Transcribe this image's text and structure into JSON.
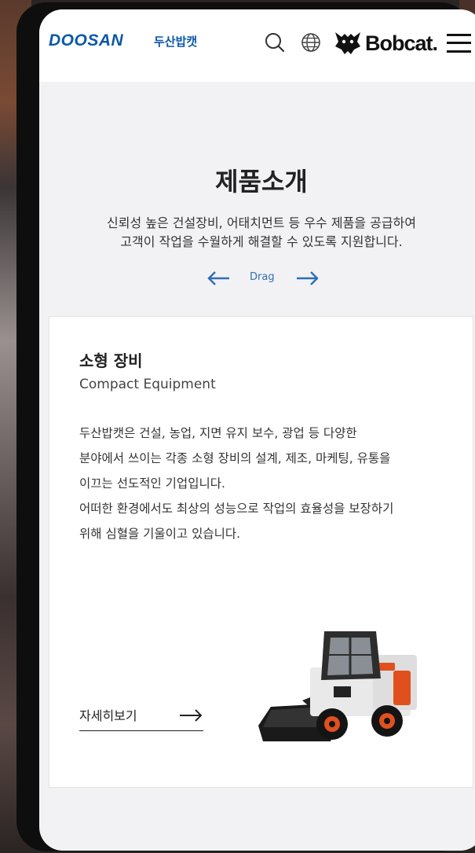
{
  "header": {
    "brand_name": "DOOSAN",
    "brand_korean": "두산밥캣",
    "partner_brand": "Bobcat.",
    "icons": [
      "search-icon",
      "globe-icon",
      "bobcat-logo-icon",
      "hamburger-menu-icon"
    ]
  },
  "intro": {
    "title": "제품소개",
    "description_lines": [
      "신뢰성 높은 건설장비, 어태치먼트 등 우수 제품을 공급하여",
      "고객이 작업을 수월하게 해결할 수 있도록 지원합니다."
    ],
    "drag_label": "Drag"
  },
  "card": {
    "title": "소형 장비",
    "subtitle": "Compact Equipment",
    "description_lines": [
      "두산밥캣은 건설, 농업, 지면 유지 보수, 광업 등 다양한",
      "분야에서 쓰이는 각종 소형 장비의 설계, 제조, 마케팅, 유통을",
      "이끄는 선도적인 기업입니다.",
      "어떠한 환경에서도 최상의 성능으로 작업의 효율성을 보장하기",
      "위해 심혈을 기울이고 있습니다."
    ],
    "more_label": "자세히보기",
    "image": "skid-steer-loader"
  },
  "colors": {
    "brand_blue": "#0b58a8",
    "accent_blue": "#2f6fb5",
    "loader_orange": "#e0501e",
    "page_background": "#f2f2f5"
  }
}
